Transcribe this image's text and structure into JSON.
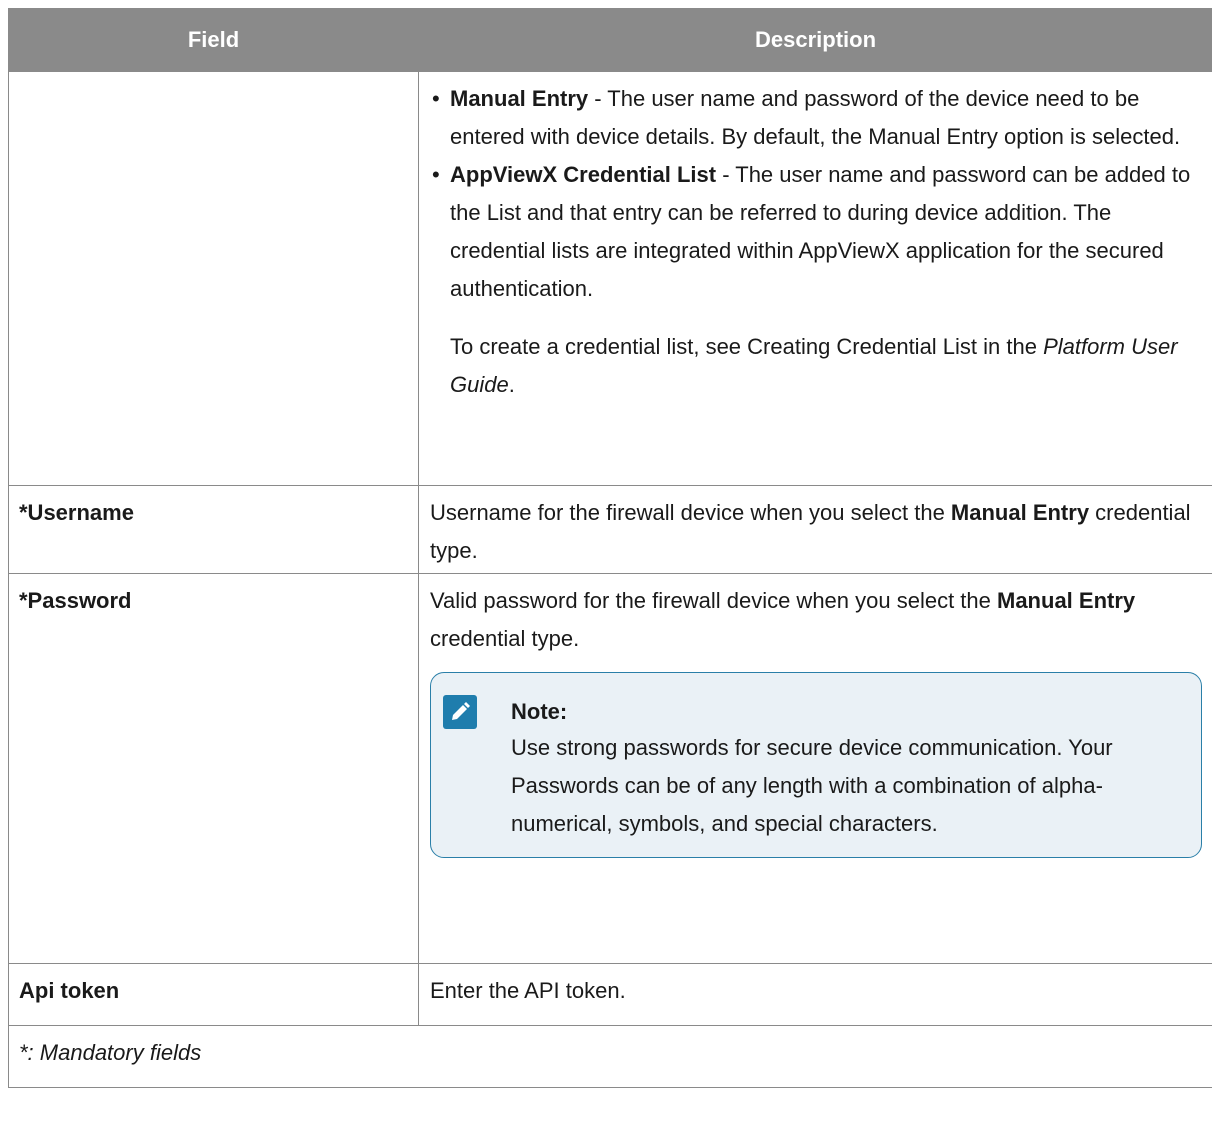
{
  "table": {
    "header_field": "Field",
    "header_description": "Description",
    "row1": {
      "bullet1_bold": "Manual Entry",
      "bullet1_text": " - The user name and password of the device need to be entered with device details. By default, the Manual Entry option is selected.",
      "bullet2_bold": "AppViewX Credential List",
      "bullet2_text": " - The user name and password can be added to the List and that entry can be referred to during device addition. The credential lists are integrated within AppViewX application for the secured authentication.",
      "para_text": "To create a credential list, see Creating Credential List in the ",
      "para_italic": "Platform User Guide",
      "para_end": "."
    },
    "row2": {
      "field": "*Username",
      "desc_pre": "Username for the firewall device when you select the ",
      "desc_bold": "Manual Entry",
      "desc_post": " credential type."
    },
    "row3": {
      "field": "*Password",
      "desc_pre": "Valid password for the firewall device when you select the ",
      "desc_bold": "Manual Entry",
      "desc_post": " credential type.",
      "note_title": "Note:",
      "note_text": "Use strong passwords for secure device communication. Your Passwords can be of any length with a combination of alpha-numerical, symbols, and special characters."
    },
    "row4": {
      "field": "Api token",
      "desc": "Enter the API token."
    },
    "footer": "*: Mandatory fields"
  },
  "icons": {
    "note": "pencil-note-icon"
  },
  "colors": {
    "header_bg": "#8a8a8a",
    "note_border": "#2a7fa8",
    "note_bg": "#eaf1f6",
    "note_icon": "#1f7dad"
  }
}
